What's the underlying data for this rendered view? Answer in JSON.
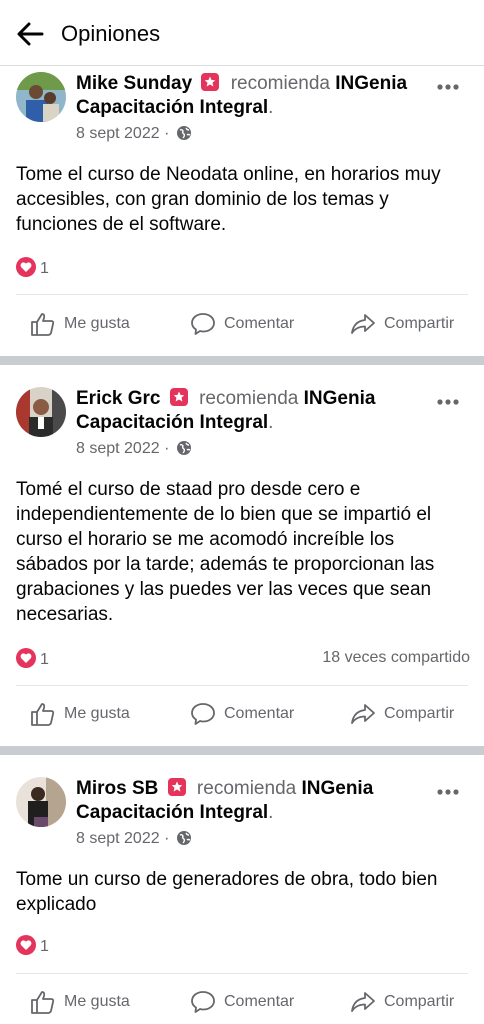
{
  "header": {
    "title": "Opiniones"
  },
  "posts": [
    {
      "author": "Mike Sunday",
      "recommends": "recomienda",
      "page": "INGenia Capacitación Integral",
      "date": "8 sept 2022 ·",
      "text": "Tome el curso de Neodata online, en horarios muy accesibles, con gran dominio de los temas y funciones de el software.",
      "reactions": "1",
      "shares": ""
    },
    {
      "author": "Erick Grc",
      "recommends": "recomienda",
      "page": "INGenia Capacitación Integral",
      "date": "8 sept 2022 ·",
      "text": "Tomé el curso de staad pro desde cero e independientemente de lo bien que se impartió el curso el horario se me acomodó increíble los sábados por la tarde; además te proporcionan las grabaciones y las puedes ver las veces que sean necesarias.",
      "reactions": "1",
      "shares": "18 veces compartido"
    },
    {
      "author": "Miros SB",
      "recommends": "recomienda",
      "page": "INGenia Capacitación Integral",
      "date": "8 sept 2022 ·",
      "text": "Tome un curso de generadores de obra, todo bien explicado",
      "reactions": "1",
      "shares": ""
    }
  ],
  "actions": {
    "like": "Me gusta",
    "comment": "Comentar",
    "share": "Compartir"
  },
  "colors": {
    "accent_badge": "#e4345c",
    "heart": "#e4345c",
    "muted": "#65676b",
    "separator": "#c9ccd1"
  }
}
